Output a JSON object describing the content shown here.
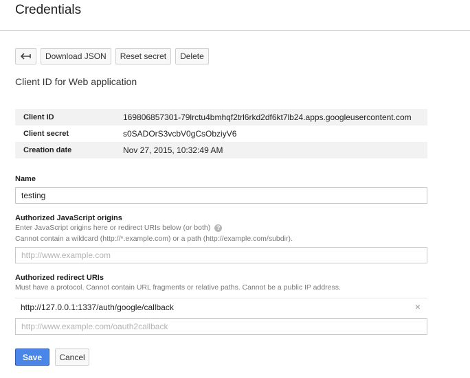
{
  "page": {
    "title": "Credentials"
  },
  "toolbar": {
    "back_icon": "back-arrow-icon",
    "download_label": "Download JSON",
    "reset_label": "Reset secret",
    "delete_label": "Delete"
  },
  "section": {
    "title": "Client ID for Web application"
  },
  "info": {
    "rows": [
      {
        "label": "Client ID",
        "value": "169806857301-79lrctu4bmhqf2trl6rkd2df6kt7lb24.apps.googleusercontent.com"
      },
      {
        "label": "Client secret",
        "value": "s0SADOrS3vcbV0gCsObziyV6"
      },
      {
        "label": "Creation date",
        "value": "Nov 27, 2015, 10:32:49 AM"
      }
    ]
  },
  "name_field": {
    "label": "Name",
    "value": "testing"
  },
  "js_origins": {
    "label": "Authorized JavaScript origins",
    "hint1": "Enter JavaScript origins here or redirect URIs below (or both)",
    "hint2": "Cannot contain a wildcard (http://*.example.com) or a path (http://example.com/subdir).",
    "placeholder": "http://www.example.com",
    "help_icon": "help-icon"
  },
  "redirect_uris": {
    "label": "Authorized redirect URIs",
    "hint": "Must have a protocol. Cannot contain URL fragments or relative paths. Cannot be a public IP address.",
    "items": [
      "http://127.0.0.1:1337/auth/google/callback"
    ],
    "remove_glyph": "×",
    "placeholder": "http://www.example.com/oauth2callback"
  },
  "actions": {
    "save_label": "Save",
    "cancel_label": "Cancel"
  },
  "colors": {
    "primary": "#4a86e8",
    "table_shade": "#f2f2f2",
    "hint_text": "#777777"
  }
}
